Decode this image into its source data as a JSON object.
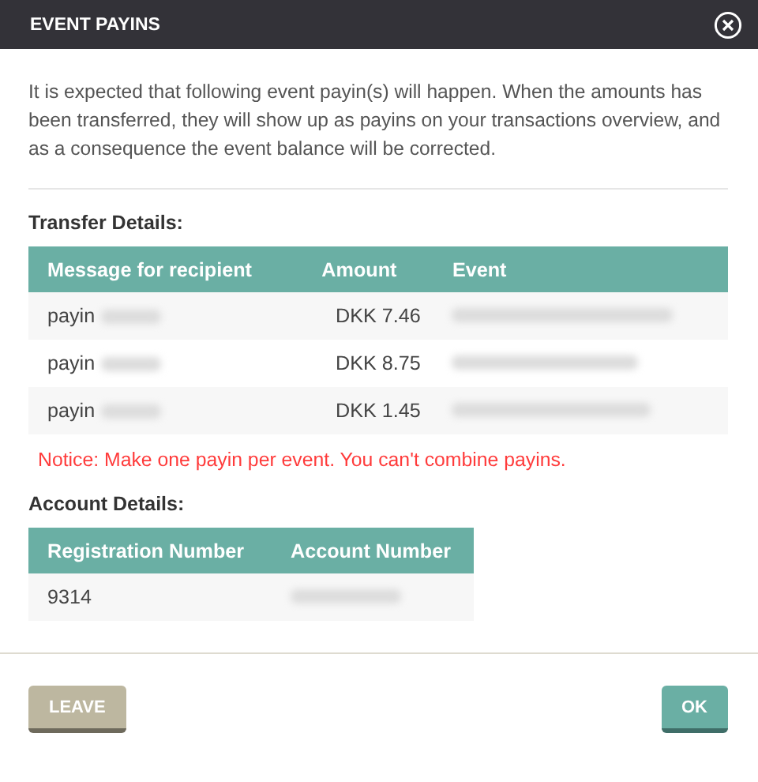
{
  "window": {
    "title": "EVENT PAYINS"
  },
  "intro": "It is expected that following event payin(s) will happen. When the amounts has been transferred, they will show up as payins on your transactions overview, and as a consequence the event balance will be corrected.",
  "transfer": {
    "heading": "Transfer Details:",
    "columns": [
      "Message for recipient",
      "Amount",
      "Event"
    ],
    "rows": [
      {
        "message": "payin",
        "message_redacted": true,
        "amount": "DKK 7.46",
        "event_redacted": true
      },
      {
        "message": "payin",
        "message_redacted": true,
        "amount": "DKK 8.75",
        "event_redacted": true
      },
      {
        "message": "payin",
        "message_redacted": true,
        "amount": "DKK 1.45",
        "event_redacted": true
      }
    ],
    "notice": "Notice: Make one payin per event. You can't combine payins."
  },
  "account": {
    "heading": "Account Details:",
    "columns": [
      "Registration Number",
      "Account Number"
    ],
    "rows": [
      {
        "registration": "9314",
        "account_redacted": true
      }
    ]
  },
  "buttons": [
    {
      "kind": "secondary",
      "label": "LEAVE"
    },
    {
      "kind": "primary",
      "label": "OK"
    }
  ]
}
